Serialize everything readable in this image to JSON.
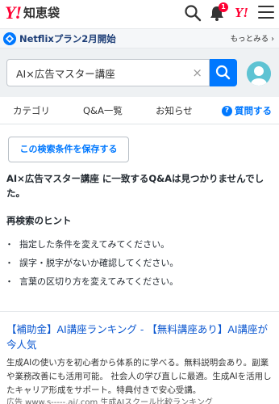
{
  "header": {
    "logo_mark": "Y!",
    "logo_text": "知恵袋",
    "notification_count": "1",
    "yahoo_badge": "Y!"
  },
  "promo": {
    "text": "Netflixプラン2月開始",
    "more": "もっとみる ›"
  },
  "search": {
    "value": "AI×広告マスター講座",
    "clear": "×"
  },
  "tabs": {
    "category": "カテゴリ",
    "qa_list": "Q&A一覧",
    "news": "お知らせ",
    "ask": "質問する",
    "ask_icon": "?"
  },
  "save_button": "この検索条件を保存する",
  "no_match": "AI×広告マスター講座 に一致するQ&Aは見つかりませんでした。",
  "hints": {
    "title": "再検索のヒント",
    "items": [
      "指定した条件を変えてみてください。",
      "誤字・脱字がないか確認してください。",
      "言葉の区切り方を変えてみてください。"
    ]
  },
  "ad": {
    "title": "【補助金】AI講座ランキング - 【無料講座あり】AI講座が今人気",
    "body": "生成AIの使い方を初心者から体系的に学べる。無料説明会あり。副業や業務改善にも活用可能。 社会人の学び直しに最適。生成AIを活用したキャリア形成をサポート。特典付きで安心受講。",
    "url": "広告 www.s-----.ai/.com 生成AIスクール比較ランキング"
  },
  "colors": {
    "brand_red": "#ff0033",
    "accent_blue": "#0078ff",
    "link_blue": "#0b57d0"
  }
}
